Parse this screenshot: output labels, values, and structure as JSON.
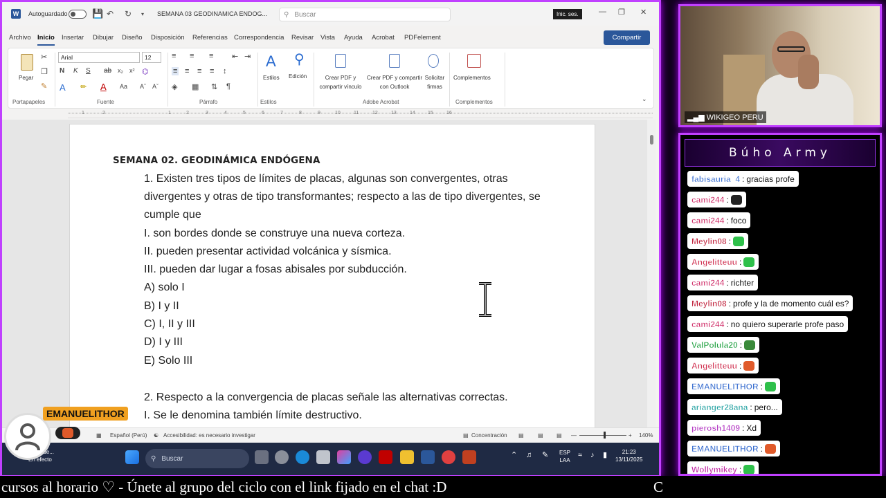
{
  "word": {
    "titlebar": {
      "autosave_label": "Autoguardado",
      "document_title": "SEMANA 03 GEODINAMICA ENDOG...",
      "search_placeholder": "Buscar",
      "signin_label": "Inic. ses."
    },
    "menu": [
      "Archivo",
      "Inicio",
      "Insertar",
      "Dibujar",
      "Diseño",
      "Disposición",
      "Referencias",
      "Correspondencia",
      "Revisar",
      "Vista",
      "Ayuda",
      "Acrobat",
      "PDFelement"
    ],
    "share_label": "Compartir",
    "ribbon": {
      "paste_label": "Pegar",
      "font_name": "Arial",
      "font_size": "12",
      "styles_label": "Estilos",
      "edit_label": "Edición",
      "create_pdf_label_1": "Crear PDF y",
      "create_pdf_label_2": "compartir vínculo",
      "create_pdf_outlook_1": "Crear PDF y compartir",
      "create_pdf_outlook_2": "con Outlook",
      "request_signatures_1": "Solicitar",
      "request_signatures_2": "firmas",
      "addins_label": "Complementos",
      "groups": {
        "clipboard": "Portapapeles",
        "font": "Fuente",
        "paragraph": "Párrafo",
        "styles": "Estilos",
        "acrobat": "Adobe Acrobat",
        "addins": "Complementos"
      }
    },
    "ruler_numbers": [
      "1",
      "2",
      "1",
      "2",
      "3",
      "4",
      "5",
      "6",
      "7",
      "8",
      "9",
      "10",
      "11",
      "12",
      "13",
      "14",
      "15",
      "16"
    ],
    "document": {
      "heading": "SEMANA 02. GEODINÁMICA ENDÓGENA",
      "lines": [
        "1. Existen tres tipos de límites de placas, algunas son convergentes, otras",
        "divergentes y otras de tipo transformantes; respecto a las de tipo divergentes, se",
        "cumple que",
        "I. son bordes donde se construye una nueva corteza.",
        "II. pueden presentar actividad volcánica y sísmica.",
        "III. pueden dar lugar a fosas abisales por subducción.",
        "A) solo I",
        "B) I y II",
        "C) I, II y III",
        "D) I y III",
        "E) Solo III",
        "2. Respecto a la convergencia de placas señale las alternativas correctas.",
        "I. Se le denomina también límite destructivo."
      ]
    },
    "statusbar": {
      "language": "Español (Perú)",
      "accessibility": "Accesibilidad: es necesario investigar",
      "focus": "Concentración",
      "zoom": "140%"
    }
  },
  "taskbar": {
    "search_placeholder": "Buscar",
    "notification_line_1": "encia de...",
    "notification_line_2": "En efecto",
    "lang_1": "ESP",
    "lang_2": "LAA",
    "time": "21:23",
    "date": "13/11/2025"
  },
  "overlay": {
    "streamer_name": "EMANUELITHOR",
    "ticker_text": "cursos al horario ♡  -  Únete al grupo del ciclo con el link fijado en el chat :D",
    "ticker_tail": "C"
  },
  "webcam": {
    "label": "WIKIGEO PERU"
  },
  "chat": {
    "title": "Búho Army",
    "messages": [
      {
        "user": "fabisauria_4",
        "text": "gracias profe",
        "color": "#3a6fd0"
      },
      {
        "user": "cami244",
        "text": "",
        "color": "#d0306a",
        "emote": "#222222"
      },
      {
        "user": "cami244",
        "text": "foco",
        "color": "#d0306a"
      },
      {
        "user": "Meylin08",
        "text": "",
        "color": "#c0203a",
        "emote": "#2ec04a"
      },
      {
        "user": "Angelitteuu",
        "text": "",
        "color": "#d03050",
        "emote": "#2ec04a"
      },
      {
        "user": "cami244",
        "text": "richter",
        "color": "#d0306a"
      },
      {
        "user": "Meylin08",
        "text": "profe y la de momento cuál es?",
        "color": "#c0203a"
      },
      {
        "user": "cami244",
        "text": "no quiero superarle profe paso",
        "color": "#d0306a"
      },
      {
        "user": "ValPolula20",
        "text": "",
        "color": "#20a040",
        "emote": "#3a8a3a"
      },
      {
        "user": "Angelitteuu",
        "text": "",
        "color": "#d03050",
        "emote": "#e05a2a"
      },
      {
        "user": "EMANUELITHOR",
        "text": "",
        "color": "#3a6fd0",
        "emote": "#2ec04a"
      },
      {
        "user": "arianger28ana",
        "text": "pero...",
        "color": "#20a0a0"
      },
      {
        "user": "pierosh1409",
        "text": "Xd",
        "color": "#b030c0"
      },
      {
        "user": "EMANUELITHOR",
        "text": "",
        "color": "#3a6fd0",
        "emote": "#e05a2a"
      },
      {
        "user": "Wollymikey",
        "text": "",
        "color": "#c020a0",
        "emote": "#2ec04a"
      }
    ]
  },
  "colors": {
    "accent_frame": "#c040ff",
    "word_blue": "#2b579a"
  }
}
